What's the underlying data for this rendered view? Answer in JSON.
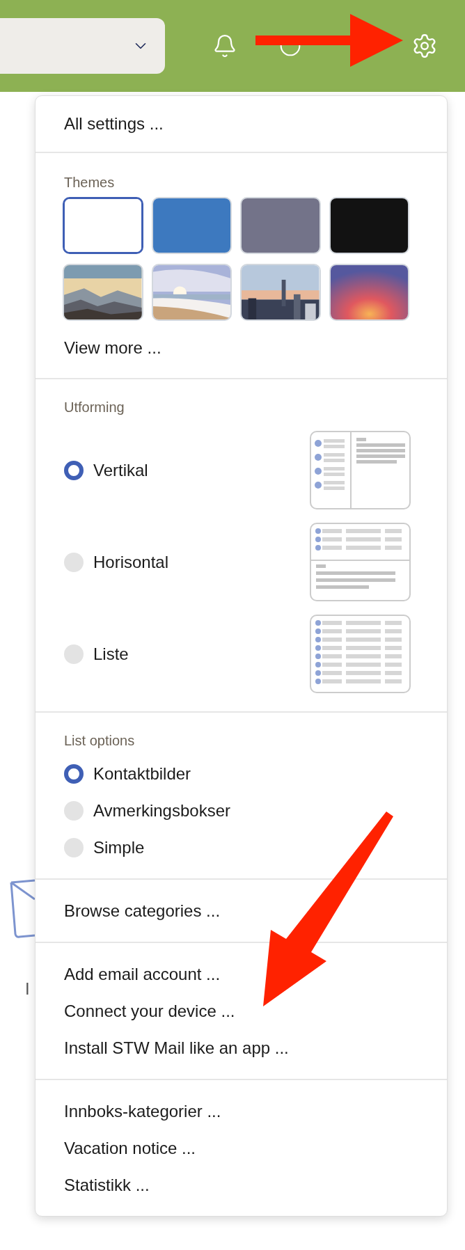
{
  "menu": {
    "all_settings": "All settings ...",
    "themes": {
      "label": "Themes",
      "swatches": [
        {
          "kind": "color",
          "color": "#ffffff",
          "selected": true
        },
        {
          "kind": "color",
          "color": "#3d79bf",
          "selected": false
        },
        {
          "kind": "color",
          "color": "#737389",
          "selected": false
        },
        {
          "kind": "color",
          "color": "#121212",
          "selected": false
        },
        {
          "kind": "picture",
          "selected": false
        },
        {
          "kind": "picture",
          "selected": false
        },
        {
          "kind": "picture",
          "selected": false
        },
        {
          "kind": "picture",
          "selected": false
        }
      ],
      "view_more": "View more ..."
    },
    "layout": {
      "label": "Utforming",
      "options": [
        {
          "label": "Vertikal",
          "selected": true,
          "kind": "vertical"
        },
        {
          "label": "Horisontal",
          "selected": false,
          "kind": "horizontal"
        },
        {
          "label": "Liste",
          "selected": false,
          "kind": "list"
        }
      ]
    },
    "list_options": {
      "label": "List options",
      "options": [
        {
          "label": "Kontaktbilder",
          "selected": true
        },
        {
          "label": "Avmerkingsbokser",
          "selected": false
        },
        {
          "label": "Simple",
          "selected": false
        }
      ]
    },
    "groups": [
      [
        "Browse categories ..."
      ],
      [
        "Add email account ...",
        "Connect your device ...",
        "Install STW Mail like an app ..."
      ],
      [
        "Innboks-kategorier ...",
        "Vacation notice ...",
        "Statistikk ..."
      ]
    ]
  },
  "background": {
    "partial_text": "I"
  }
}
